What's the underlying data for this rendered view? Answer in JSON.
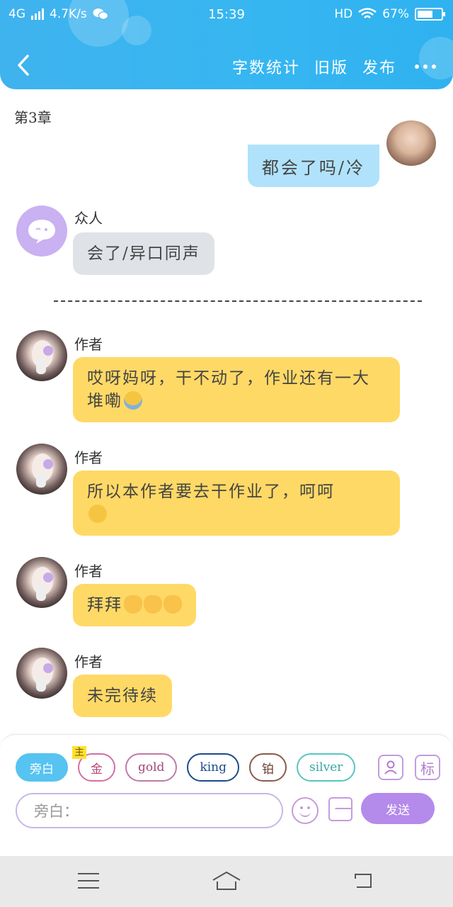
{
  "status_bar": {
    "network": "4G",
    "speed": "4.7K/s",
    "time": "15:39",
    "hd": "HD",
    "battery": "67%",
    "battery_level": 0.67
  },
  "nav": {
    "word_count": "字数统计",
    "old_version": "旧版",
    "publish": "发布"
  },
  "chapter_title": "第3章",
  "messages": {
    "top_right": "都会了吗/冷",
    "crowd_name": "众人",
    "crowd_text": "会了/异口同声",
    "author_name": "作者",
    "a1_text": "哎呀妈呀，干不动了，作业还有一大堆嘞",
    "a2_text": "所以本作者要去干作业了，呵呵",
    "a3_text": "拜拜",
    "a4_text": "未完待续"
  },
  "composer": {
    "tags": [
      "旁白",
      "金",
      "gold",
      "king",
      "铂",
      "silver"
    ],
    "main_badge": "主",
    "tag_icon_label": "标",
    "placeholder": "旁白：",
    "send": "发送"
  },
  "colors": {
    "header": "#36b6f1",
    "author_bubble": "#ffd966",
    "crowd_bubble": "#dfe3e8",
    "self_bubble": "#b0e2fb",
    "send_button": "#b48aeb"
  }
}
